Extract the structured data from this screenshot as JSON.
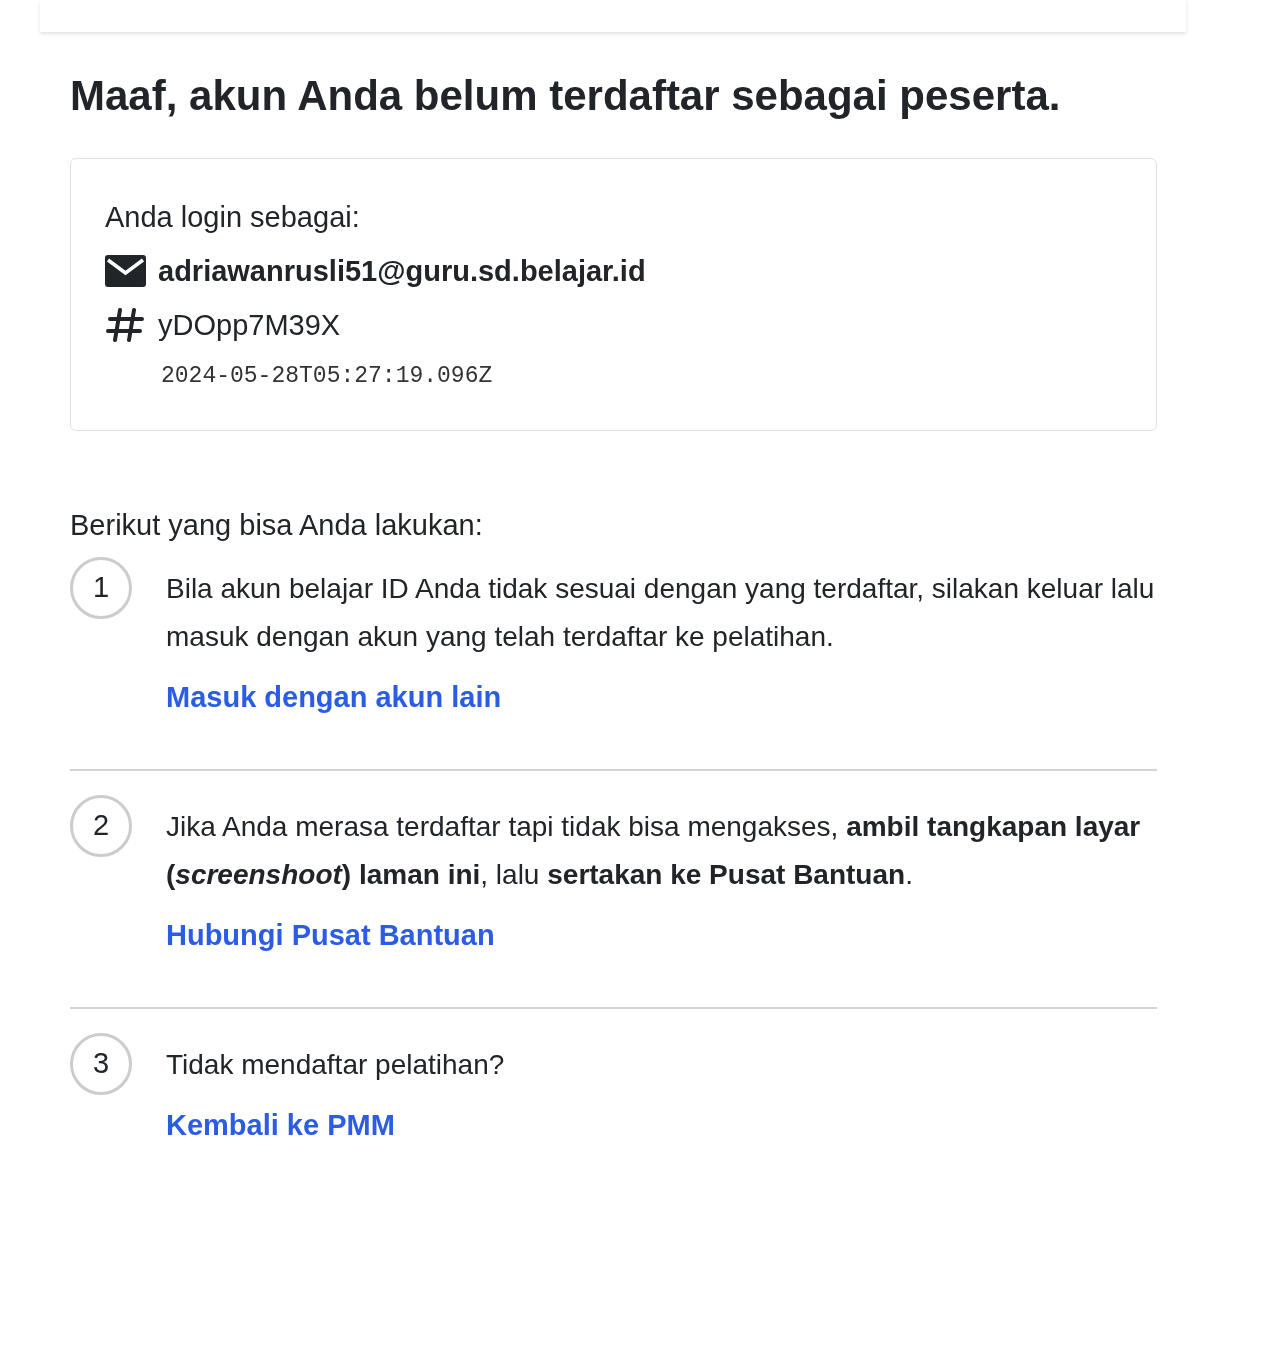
{
  "title": "Maaf, akun Anda belum terdaftar sebagai peserta.",
  "account": {
    "label": "Anda login sebagai:",
    "email": "adriawanrusli51@guru.sd.belajar.id",
    "id": "yDOpp7M39X",
    "timestamp": "2024-05-28T05:27:19.096Z"
  },
  "intro": "Berikut yang bisa Anda lakukan:",
  "steps": [
    {
      "number": "1",
      "text": "Bila akun belajar ID Anda tidak sesuai dengan yang terdaftar, silakan keluar lalu masuk dengan akun yang telah terdaftar ke pelatihan.",
      "link": "Masuk dengan akun lain"
    },
    {
      "number": "2",
      "text": "Jika Anda merasa terdaftar tapi tidak bisa mengakses, **ambil tangkapan layar (*screenshoot*) laman ini**, lalu **sertakan ke Pusat Bantuan**.",
      "link": "Hubungi Pusat Bantuan"
    },
    {
      "number": "3",
      "text": "Tidak mendaftar pelatihan?",
      "link": "Kembali ke PMM"
    }
  ]
}
